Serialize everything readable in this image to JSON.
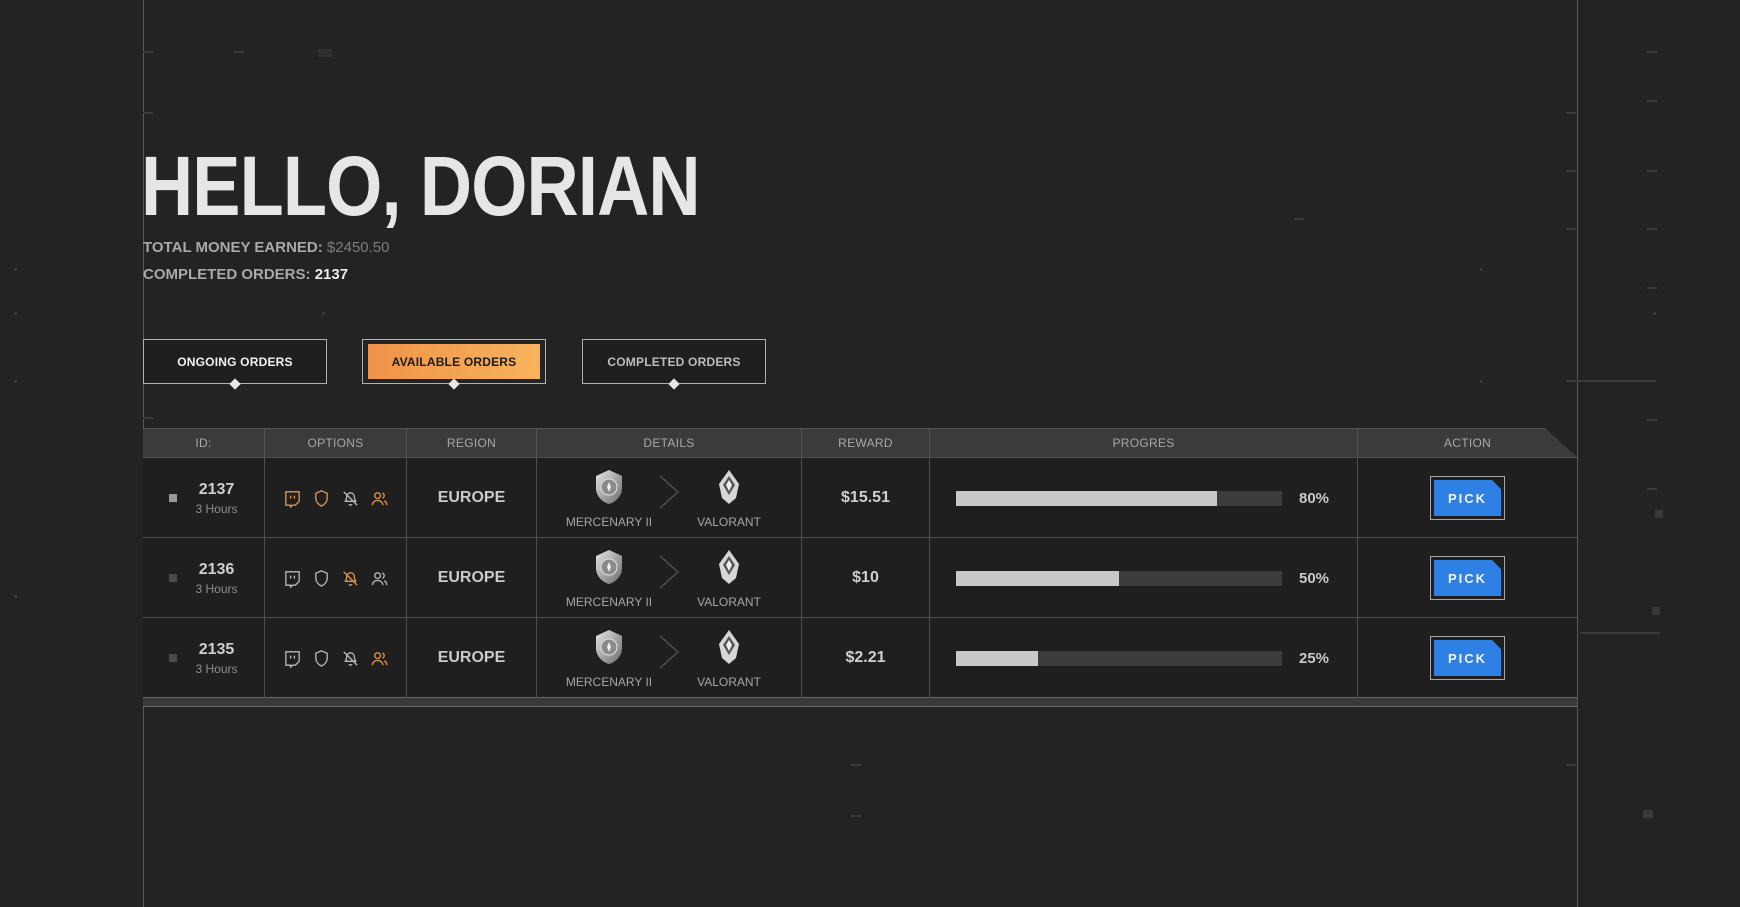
{
  "greeting": "HELLO, DORIAN",
  "stats": {
    "money_label": "TOTAL MONEY EARNED:",
    "money_value": "$2450.50",
    "orders_label": "COMPLETED ORDERS:",
    "orders_value": "2137"
  },
  "tabs": [
    {
      "label": "ONGOING ORDERS",
      "active": false
    },
    {
      "label": "AVAILABLE ORDERS",
      "active": true
    },
    {
      "label": "COMPLETED ORDERS",
      "active": false
    }
  ],
  "table": {
    "headers": [
      "ID:",
      "OPTIONS",
      "REGION",
      "DETAILS",
      "REWARD",
      "PROGRES",
      "ACTION"
    ],
    "rows": [
      {
        "id": "2137",
        "time": "3 Hours",
        "region": "EUROPE",
        "rank": "MERCENARY II",
        "game": "VALORANT",
        "reward": "$15.51",
        "progress": 0.8,
        "progress_label": "80%",
        "action": "PICK",
        "active_options": [
          "stream",
          "shield",
          "people"
        ]
      },
      {
        "id": "2136",
        "time": "3 Hours",
        "region": "EUROPE",
        "rank": "MERCENARY II",
        "game": "VALORANT",
        "reward": "$10",
        "progress": 0.5,
        "progress_label": "50%",
        "action": "PICK",
        "active_options": [
          "notify"
        ]
      },
      {
        "id": "2135",
        "time": "3 Hours",
        "region": "EUROPE",
        "rank": "MERCENARY II",
        "game": "VALORANT",
        "reward": "$2.21",
        "progress": 0.25,
        "progress_label": "25%",
        "action": "PICK",
        "active_options": [
          "people"
        ]
      }
    ]
  },
  "icons": {
    "options": [
      "stream-icon",
      "shield-icon",
      "bell-off-icon",
      "users-icon"
    ],
    "details": [
      "rank-badge-icon",
      "chevron-right-icon",
      "valorant-logo-icon"
    ]
  },
  "colors": {
    "accent_orange": "#ef9349",
    "pick_blue": "#2f80e4",
    "option_inactive": "#b9b9b9",
    "option_active": "#e0954f"
  }
}
